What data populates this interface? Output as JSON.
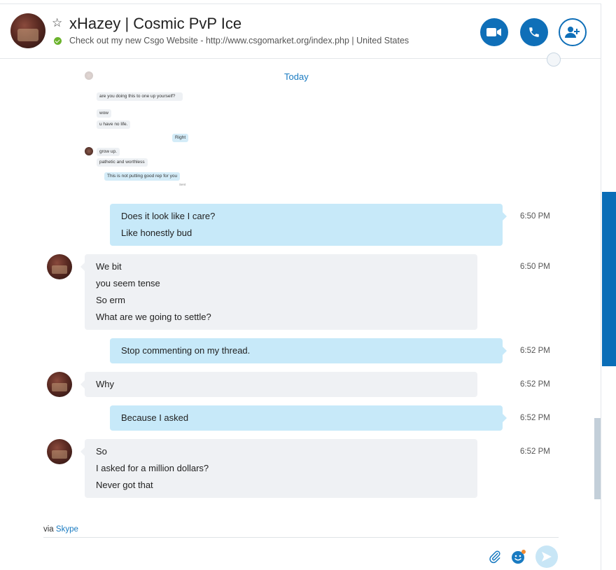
{
  "header": {
    "title": "xHazey | Cosmic PvP Ice",
    "mood": "Check out my new Csgo Website - http://www.csgomarket.org/index.php  |  United States",
    "icons": [
      "star-icon",
      "online-status-icon",
      "video-call-icon",
      "audio-call-icon",
      "add-people-icon"
    ]
  },
  "conversation": {
    "date_divider": "Today",
    "screenshot": {
      "messages": [
        {
          "text": "are you doing this to one up yourself?",
          "from": "them"
        },
        {
          "text": "wow",
          "from": "them"
        },
        {
          "text": "u have no life.",
          "from": "them"
        },
        {
          "text": "Right",
          "from": "me"
        },
        {
          "text": "grow up.",
          "from": "them"
        },
        {
          "text": "pathetic and worthless",
          "from": "them"
        },
        {
          "text": "This is not putting good rep for you",
          "from": "me"
        }
      ],
      "sent_label": "Sent"
    },
    "messages": [
      {
        "from": "me",
        "time": "6:50 PM",
        "lines": [
          "Does it look like I care?",
          "Like honestly bud"
        ]
      },
      {
        "from": "them",
        "time": "6:50 PM",
        "lines": [
          "We bit",
          "you seem tense",
          "So erm",
          "What are we going to settle?"
        ]
      },
      {
        "from": "me",
        "time": "6:52 PM",
        "lines": [
          "Stop commenting on my thread."
        ]
      },
      {
        "from": "them",
        "time": "6:52 PM",
        "lines": [
          "Why"
        ]
      },
      {
        "from": "me",
        "time": "6:52 PM",
        "lines": [
          "Because I asked"
        ]
      },
      {
        "from": "them",
        "time": "6:52 PM",
        "lines": [
          "So",
          "I asked for a million dollars?",
          "Never got that"
        ]
      }
    ]
  },
  "footer": {
    "via_prefix": "via",
    "via_link": "Skype",
    "icons": [
      "attach-icon",
      "emoji-icon",
      "send-icon"
    ]
  },
  "colors": {
    "accent": "#0f6fb8",
    "link": "#1a7bc1",
    "my_bubble": "#c7e9f9",
    "their_bubble": "#eff1f4",
    "online": "#6bb32c"
  }
}
